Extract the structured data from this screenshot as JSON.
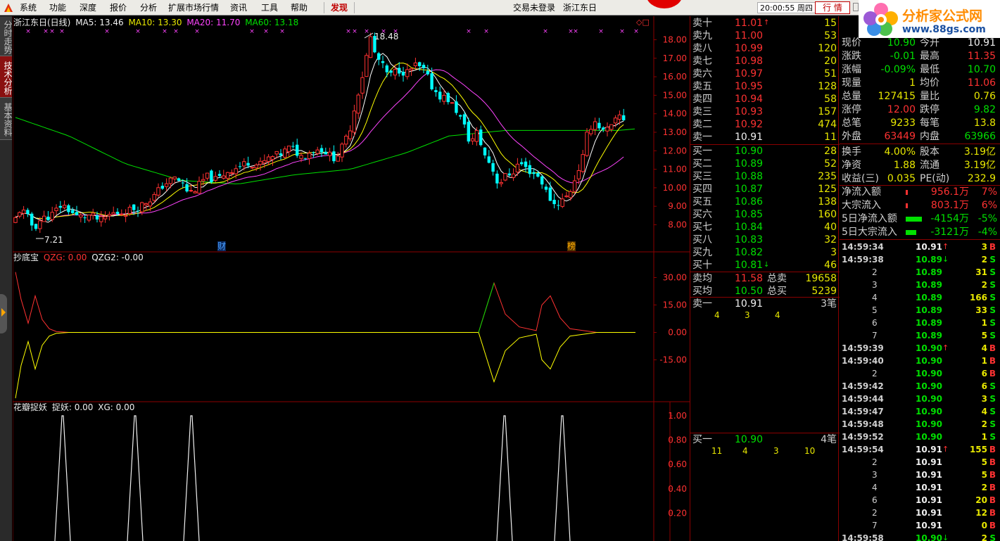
{
  "menu": {
    "items": [
      "系统",
      "功能",
      "深度",
      "报价",
      "分析",
      "扩展市场行情",
      "资讯",
      "工具",
      "帮助"
    ],
    "discover": "发现",
    "login_status": "交易未登录",
    "stock_name": "浙江东日",
    "clock": "20:00:55 周四",
    "quote_tab": "行 情"
  },
  "brand": {
    "title": "分析家公式网",
    "url": "www.88gs.com"
  },
  "left_tabs": [
    "分时走势",
    "技术分析",
    "基本资料"
  ],
  "main_chart": {
    "title": "浙江东日(日线)",
    "ma": [
      {
        "label": "MA5: 13.46",
        "color": "#f0f0f0"
      },
      {
        "label": "MA10: 13.30",
        "color": "#e8e800"
      },
      {
        "label": "MA20: 11.70",
        "color": "#ff44ff"
      },
      {
        "label": "MA60: 13.18",
        "color": "#00e000"
      }
    ],
    "high_label": "18.48",
    "low_label": "7.21",
    "markers": [
      "财",
      "榜"
    ],
    "y_ticks": [
      "18.00",
      "17.00",
      "16.00",
      "15.00",
      "14.00",
      "13.00",
      "12.00",
      "11.00",
      "10.00",
      "9.00",
      "8.00"
    ]
  },
  "ind1": {
    "name": "抄底宝",
    "params": [
      {
        "label": "QZG: 0.00",
        "color": "#ff3232"
      },
      {
        "label": "QZG2: -0.00",
        "color": "#f0f0f0"
      }
    ],
    "y_ticks": [
      "30.00",
      "15.00",
      "0.00",
      "-15.00"
    ]
  },
  "ind2": {
    "name": "花瓣捉妖",
    "params": [
      {
        "label": "捉妖: 0.00",
        "color": "#f0f0f0"
      },
      {
        "label": "XG: 0.00",
        "color": "#f0f0f0"
      }
    ],
    "y_ticks": [
      "1.00",
      "0.80",
      "0.60",
      "0.40",
      "0.20"
    ]
  },
  "colors": {
    "up": "#ff3232",
    "down": "#00ffff",
    "ma5": "#ffffff",
    "ma10": "#ffff00",
    "ma20": "#ff44ff",
    "ma60": "#00e000",
    "frame": "#8b0000",
    "axis_text": "#ff3232"
  },
  "order_book": {
    "asks": [
      {
        "label": "卖十",
        "price": "11.01",
        "color": "red",
        "arrow": "↑",
        "vol": "15"
      },
      {
        "label": "卖九",
        "price": "11.00",
        "color": "red",
        "arrow": "",
        "vol": "53"
      },
      {
        "label": "卖八",
        "price": "10.99",
        "color": "red",
        "arrow": "",
        "vol": "120"
      },
      {
        "label": "卖七",
        "price": "10.98",
        "color": "red",
        "arrow": "",
        "vol": "20"
      },
      {
        "label": "卖六",
        "price": "10.97",
        "color": "red",
        "arrow": "",
        "vol": "51"
      },
      {
        "label": "卖五",
        "price": "10.95",
        "color": "red",
        "arrow": "",
        "vol": "128"
      },
      {
        "label": "卖四",
        "price": "10.94",
        "color": "red",
        "arrow": "",
        "vol": "58"
      },
      {
        "label": "卖三",
        "price": "10.93",
        "color": "red",
        "arrow": "",
        "vol": "157"
      },
      {
        "label": "卖二",
        "price": "10.92",
        "color": "red",
        "arrow": "",
        "vol": "474"
      },
      {
        "label": "卖一",
        "price": "10.91",
        "color": "white",
        "arrow": "",
        "vol": "11"
      }
    ],
    "bids": [
      {
        "label": "买一",
        "price": "10.90",
        "color": "green",
        "arrow": "",
        "vol": "28"
      },
      {
        "label": "买二",
        "price": "10.89",
        "color": "green",
        "arrow": "",
        "vol": "52"
      },
      {
        "label": "买三",
        "price": "10.88",
        "color": "green",
        "arrow": "",
        "vol": "235"
      },
      {
        "label": "买四",
        "price": "10.87",
        "color": "green",
        "arrow": "",
        "vol": "125"
      },
      {
        "label": "买五",
        "price": "10.86",
        "color": "green",
        "arrow": "",
        "vol": "138"
      },
      {
        "label": "买六",
        "price": "10.85",
        "color": "green",
        "arrow": "",
        "vol": "160"
      },
      {
        "label": "买七",
        "price": "10.84",
        "color": "green",
        "arrow": "",
        "vol": "40"
      },
      {
        "label": "买八",
        "price": "10.83",
        "color": "green",
        "arrow": "",
        "vol": "32"
      },
      {
        "label": "买九",
        "price": "10.82",
        "color": "green",
        "arrow": "",
        "vol": "3"
      },
      {
        "label": "买十",
        "price": "10.81",
        "color": "green",
        "arrow": "↓",
        "vol": "46"
      }
    ],
    "avg_sell": {
      "label": "卖均",
      "price": "11.58",
      "total_label": "总卖",
      "total": "19658"
    },
    "avg_buy": {
      "label": "买均",
      "price": "10.50",
      "total_label": "总买",
      "total": "5239"
    },
    "ask1_queue": {
      "label": "卖一",
      "price": "10.91",
      "count": "3笔",
      "orders": [
        "4",
        "3",
        "4"
      ]
    },
    "bid1_queue": {
      "label": "买一",
      "price": "10.90",
      "count": "4笔",
      "orders": [
        "11",
        "4",
        "3",
        "10"
      ]
    }
  },
  "stats": [
    {
      "k1": "现价",
      "v1": "10.90",
      "c1": "green",
      "k2": "今开",
      "v2": "10.91",
      "c2": "white"
    },
    {
      "k1": "涨跌",
      "v1": "-0.01",
      "c1": "green",
      "k2": "最高",
      "v2": "11.35",
      "c2": "red"
    },
    {
      "k1": "涨幅",
      "v1": "-0.09%",
      "c1": "green",
      "k2": "最低",
      "v2": "10.70",
      "c2": "green"
    },
    {
      "k1": "现量",
      "v1": "1",
      "c1": "yellow",
      "k2": "均价",
      "v2": "11.06",
      "c2": "red"
    },
    {
      "k1": "总量",
      "v1": "127415",
      "c1": "yellow",
      "k2": "量比",
      "v2": "0.76",
      "c2": "yellow"
    },
    {
      "k1": "涨停",
      "v1": "12.00",
      "c1": "red",
      "k2": "跌停",
      "v2": "9.82",
      "c2": "green"
    },
    {
      "k1": "总笔",
      "v1": "9233",
      "c1": "yellow",
      "k2": "每笔",
      "v2": "13.8",
      "c2": "yellow"
    },
    {
      "k1": "外盘",
      "v1": "63449",
      "c1": "red",
      "k2": "内盘",
      "v2": "63966",
      "c2": "green"
    },
    {
      "k1": "换手",
      "v1": "4.00%",
      "c1": "yellow",
      "k2": "股本",
      "v2": "3.19亿",
      "c2": "yellow"
    },
    {
      "k1": "净资",
      "v1": "1.88",
      "c1": "yellow",
      "k2": "流通",
      "v2": "3.19亿",
      "c2": "yellow"
    },
    {
      "k1": "收益(三)",
      "v1": "0.035",
      "c1": "yellow",
      "k2": "PE(动)",
      "v2": "232.9",
      "c2": "yellow"
    }
  ],
  "flows": [
    {
      "label": "净流入额",
      "value": "956.1万",
      "pct": "7%",
      "color": "red",
      "bar": 0.06
    },
    {
      "label": "大宗流入",
      "value": "803.1万",
      "pct": "6%",
      "color": "red",
      "bar": 0.05
    },
    {
      "label": "5日净流入额",
      "value": "-4154万",
      "pct": "-5%",
      "color": "green",
      "bar": 0.45
    },
    {
      "label": "5日大宗流入",
      "value": "-3121万",
      "pct": "-4%",
      "color": "green",
      "bar": 0.3
    }
  ],
  "ticks": [
    {
      "time": "14:59:34",
      "price": "10.91",
      "pc": "white",
      "arrow": "↑",
      "ac": "red",
      "vol": "3",
      "dir": "B"
    },
    {
      "time": "14:59:38",
      "price": "10.89",
      "pc": "green",
      "arrow": "↓",
      "ac": "green",
      "vol": "2",
      "dir": "S"
    },
    {
      "time": "2",
      "price": "10.89",
      "pc": "green",
      "arrow": "",
      "ac": "",
      "vol": "31",
      "dir": "S"
    },
    {
      "time": "3",
      "price": "10.89",
      "pc": "green",
      "arrow": "",
      "ac": "",
      "vol": "2",
      "dir": "S"
    },
    {
      "time": "4",
      "price": "10.89",
      "pc": "green",
      "arrow": "",
      "ac": "",
      "vol": "166",
      "dir": "S"
    },
    {
      "time": "5",
      "price": "10.89",
      "pc": "green",
      "arrow": "",
      "ac": "",
      "vol": "33",
      "dir": "S"
    },
    {
      "time": "6",
      "price": "10.89",
      "pc": "green",
      "arrow": "",
      "ac": "",
      "vol": "1",
      "dir": "S"
    },
    {
      "time": "7",
      "price": "10.89",
      "pc": "green",
      "arrow": "",
      "ac": "",
      "vol": "5",
      "dir": "S"
    },
    {
      "time": "14:59:39",
      "price": "10.90",
      "pc": "green",
      "arrow": "↑",
      "ac": "red",
      "vol": "4",
      "dir": "B"
    },
    {
      "time": "14:59:40",
      "price": "10.90",
      "pc": "green",
      "arrow": "",
      "ac": "",
      "vol": "1",
      "dir": "B"
    },
    {
      "time": "2",
      "price": "10.90",
      "pc": "green",
      "arrow": "",
      "ac": "",
      "vol": "6",
      "dir": "B"
    },
    {
      "time": "14:59:42",
      "price": "10.90",
      "pc": "green",
      "arrow": "",
      "ac": "",
      "vol": "6",
      "dir": "S"
    },
    {
      "time": "14:59:44",
      "price": "10.90",
      "pc": "green",
      "arrow": "",
      "ac": "",
      "vol": "3",
      "dir": "S"
    },
    {
      "time": "14:59:47",
      "price": "10.90",
      "pc": "green",
      "arrow": "",
      "ac": "",
      "vol": "4",
      "dir": "S"
    },
    {
      "time": "14:59:48",
      "price": "10.90",
      "pc": "green",
      "arrow": "",
      "ac": "",
      "vol": "2",
      "dir": "S"
    },
    {
      "time": "14:59:52",
      "price": "10.90",
      "pc": "green",
      "arrow": "",
      "ac": "",
      "vol": "1",
      "dir": "S"
    },
    {
      "time": "14:59:54",
      "price": "10.91",
      "pc": "white",
      "arrow": "↑",
      "ac": "red",
      "vol": "155",
      "dir": "B"
    },
    {
      "time": "2",
      "price": "10.91",
      "pc": "white",
      "arrow": "",
      "ac": "",
      "vol": "5",
      "dir": "B"
    },
    {
      "time": "3",
      "price": "10.91",
      "pc": "white",
      "arrow": "",
      "ac": "",
      "vol": "5",
      "dir": "B"
    },
    {
      "time": "4",
      "price": "10.91",
      "pc": "white",
      "arrow": "",
      "ac": "",
      "vol": "2",
      "dir": "B"
    },
    {
      "time": "6",
      "price": "10.91",
      "pc": "white",
      "arrow": "",
      "ac": "",
      "vol": "20",
      "dir": "B"
    },
    {
      "time": "2",
      "price": "10.91",
      "pc": "white",
      "arrow": "",
      "ac": "",
      "vol": "12",
      "dir": "B"
    },
    {
      "time": "7",
      "price": "10.91",
      "pc": "white",
      "arrow": "",
      "ac": "",
      "vol": "0",
      "dir": "B"
    },
    {
      "time": "14:59:58",
      "price": "10.90",
      "pc": "green",
      "arrow": "↓",
      "ac": "green",
      "vol": "2",
      "dir": "S"
    }
  ]
}
